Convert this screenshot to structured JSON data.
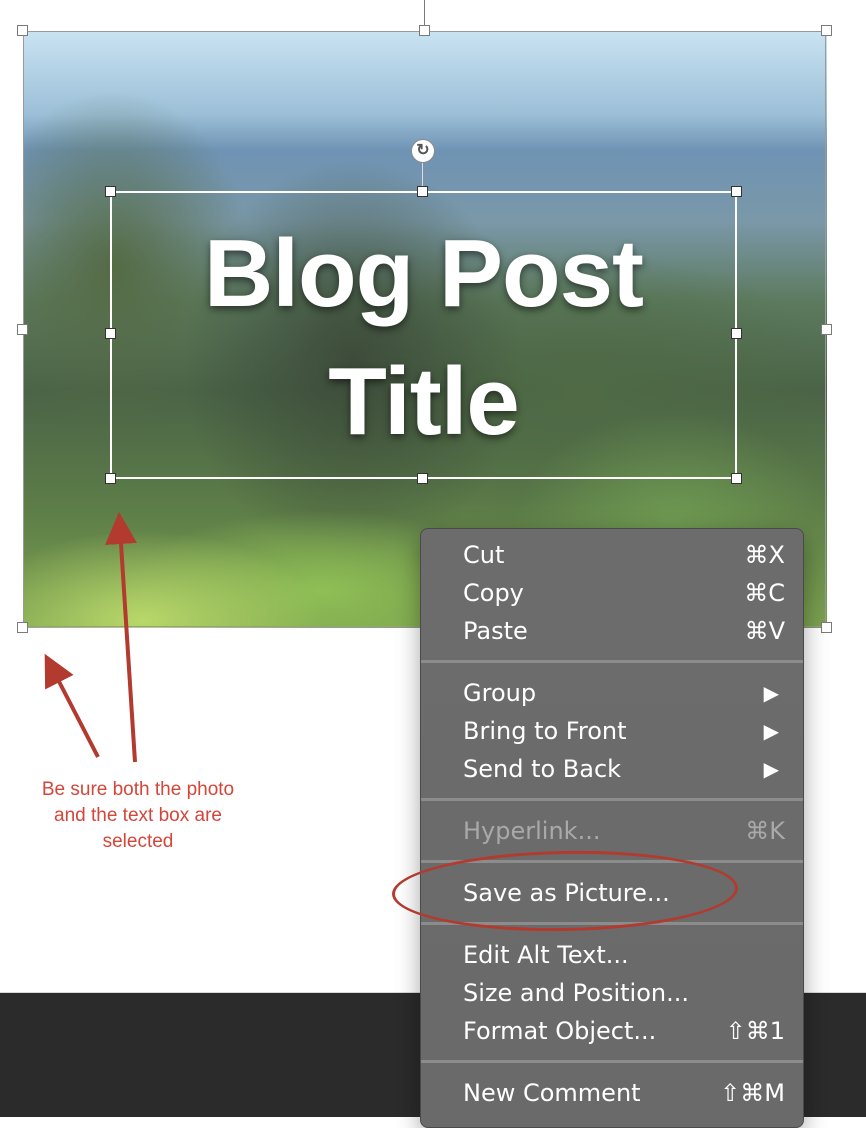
{
  "slide": {
    "title_line1": "Blog Post",
    "title_line2": "Title"
  },
  "annotation": {
    "note": "Be sure both the photo and the text box are selected",
    "color": "#d4453a"
  },
  "context_menu": {
    "items": [
      {
        "label": "Cut",
        "shortcut": "⌘X"
      },
      {
        "label": "Copy",
        "shortcut": "⌘C"
      },
      {
        "label": "Paste",
        "shortcut": "⌘V"
      },
      {
        "label": "Group",
        "submenu": "▶"
      },
      {
        "label": "Bring to Front",
        "submenu": "▶"
      },
      {
        "label": "Send to Back",
        "submenu": "▶"
      },
      {
        "label": "Hyperlink...",
        "shortcut": "⌘K",
        "disabled": true
      },
      {
        "label": "Save as Picture..."
      },
      {
        "label": "Edit Alt Text..."
      },
      {
        "label": "Size and Position..."
      },
      {
        "label": "Format Object...",
        "shortcut": "⇧⌘1"
      },
      {
        "label": "New Comment",
        "shortcut": "⇧⌘M"
      }
    ],
    "highlight_color": "#b23a2e"
  },
  "icons": {
    "rotate_handle": "↻",
    "submenu_arrow": "submenu-arrow-icon"
  }
}
